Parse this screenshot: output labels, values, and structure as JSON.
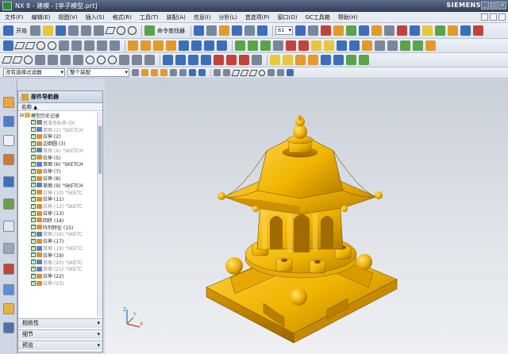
{
  "window": {
    "title": "NX 8 - 建模 - [亭子模型.prt]",
    "brand": "SIEMENS"
  },
  "menu": [
    "文件(F)",
    "编辑(E)",
    "视图(V)",
    "插入(S)",
    "格式(R)",
    "工具(T)",
    "装配(A)",
    "信息(I)",
    "分析(L)",
    "首选项(P)",
    "窗口(O)",
    "GC工具箱",
    "帮助(H)"
  ],
  "toolbar": {
    "start_label": "开始",
    "command_finder": "命令查找器",
    "zoom_value": "61"
  },
  "selection_bar": {
    "filter_value": "没有选择过滤器",
    "scope_value": "整个装配"
  },
  "navigator": {
    "title": "部件导航器",
    "column_name": "名称",
    "root": "模型历史记录",
    "items": [
      {
        "label": "基准坐标系 (0)",
        "kind": "dt",
        "gray": true
      },
      {
        "label": "草图 (1) \"SKETCH",
        "kind": "sk",
        "gray": true
      },
      {
        "label": "拉伸 (2)",
        "kind": "ex",
        "gray": false
      },
      {
        "label": "边倒圆 (3)",
        "kind": "ex",
        "gray": false
      },
      {
        "label": "草图 (4) \"SKETCH",
        "kind": "sk",
        "gray": true
      },
      {
        "label": "拉伸 (5)",
        "kind": "ex",
        "gray": false
      },
      {
        "label": "草图 (6) \"SKETCH",
        "kind": "sk",
        "gray": false
      },
      {
        "label": "拉伸 (7)",
        "kind": "ex",
        "gray": false
      },
      {
        "label": "拉伸 (8)",
        "kind": "ex",
        "gray": false
      },
      {
        "label": "草图 (9) \"SKETCH",
        "kind": "sk",
        "gray": false
      },
      {
        "label": "拉伸 (10) \"SKETC",
        "kind": "ex",
        "gray": true
      },
      {
        "label": "拉伸 (11)",
        "kind": "ex",
        "gray": false
      },
      {
        "label": "拉伸 (12) \"SKETC",
        "kind": "ex",
        "gray": true
      },
      {
        "label": "拉伸 (13)",
        "kind": "ex",
        "gray": false
      },
      {
        "label": "回转 (14)",
        "kind": "ex",
        "gray": false
      },
      {
        "label": "阵列特征 (15)",
        "kind": "ex",
        "gray": false
      },
      {
        "label": "草图 (16) \"SKETC",
        "kind": "sk",
        "gray": true
      },
      {
        "label": "拉伸 (17)",
        "kind": "ex",
        "gray": false
      },
      {
        "label": "草图 (18) \"SKETC",
        "kind": "sk",
        "gray": true
      },
      {
        "label": "拉伸 (19)",
        "kind": "ex",
        "gray": false
      },
      {
        "label": "草图 (20) \"SKETC",
        "kind": "sk",
        "gray": true
      },
      {
        "label": "草图 (21) \"SKETC",
        "kind": "sk",
        "gray": true
      },
      {
        "label": "拉伸 (22)",
        "kind": "ex",
        "gray": false
      },
      {
        "label": "拉伸 (23)",
        "kind": "ex",
        "gray": true
      }
    ],
    "panels": [
      "相依性",
      "细节",
      "预览"
    ]
  },
  "colors": {
    "model_gold": "#f0b400",
    "model_shadow": "#b07a00",
    "viewport_top": "#c9cfd8"
  }
}
